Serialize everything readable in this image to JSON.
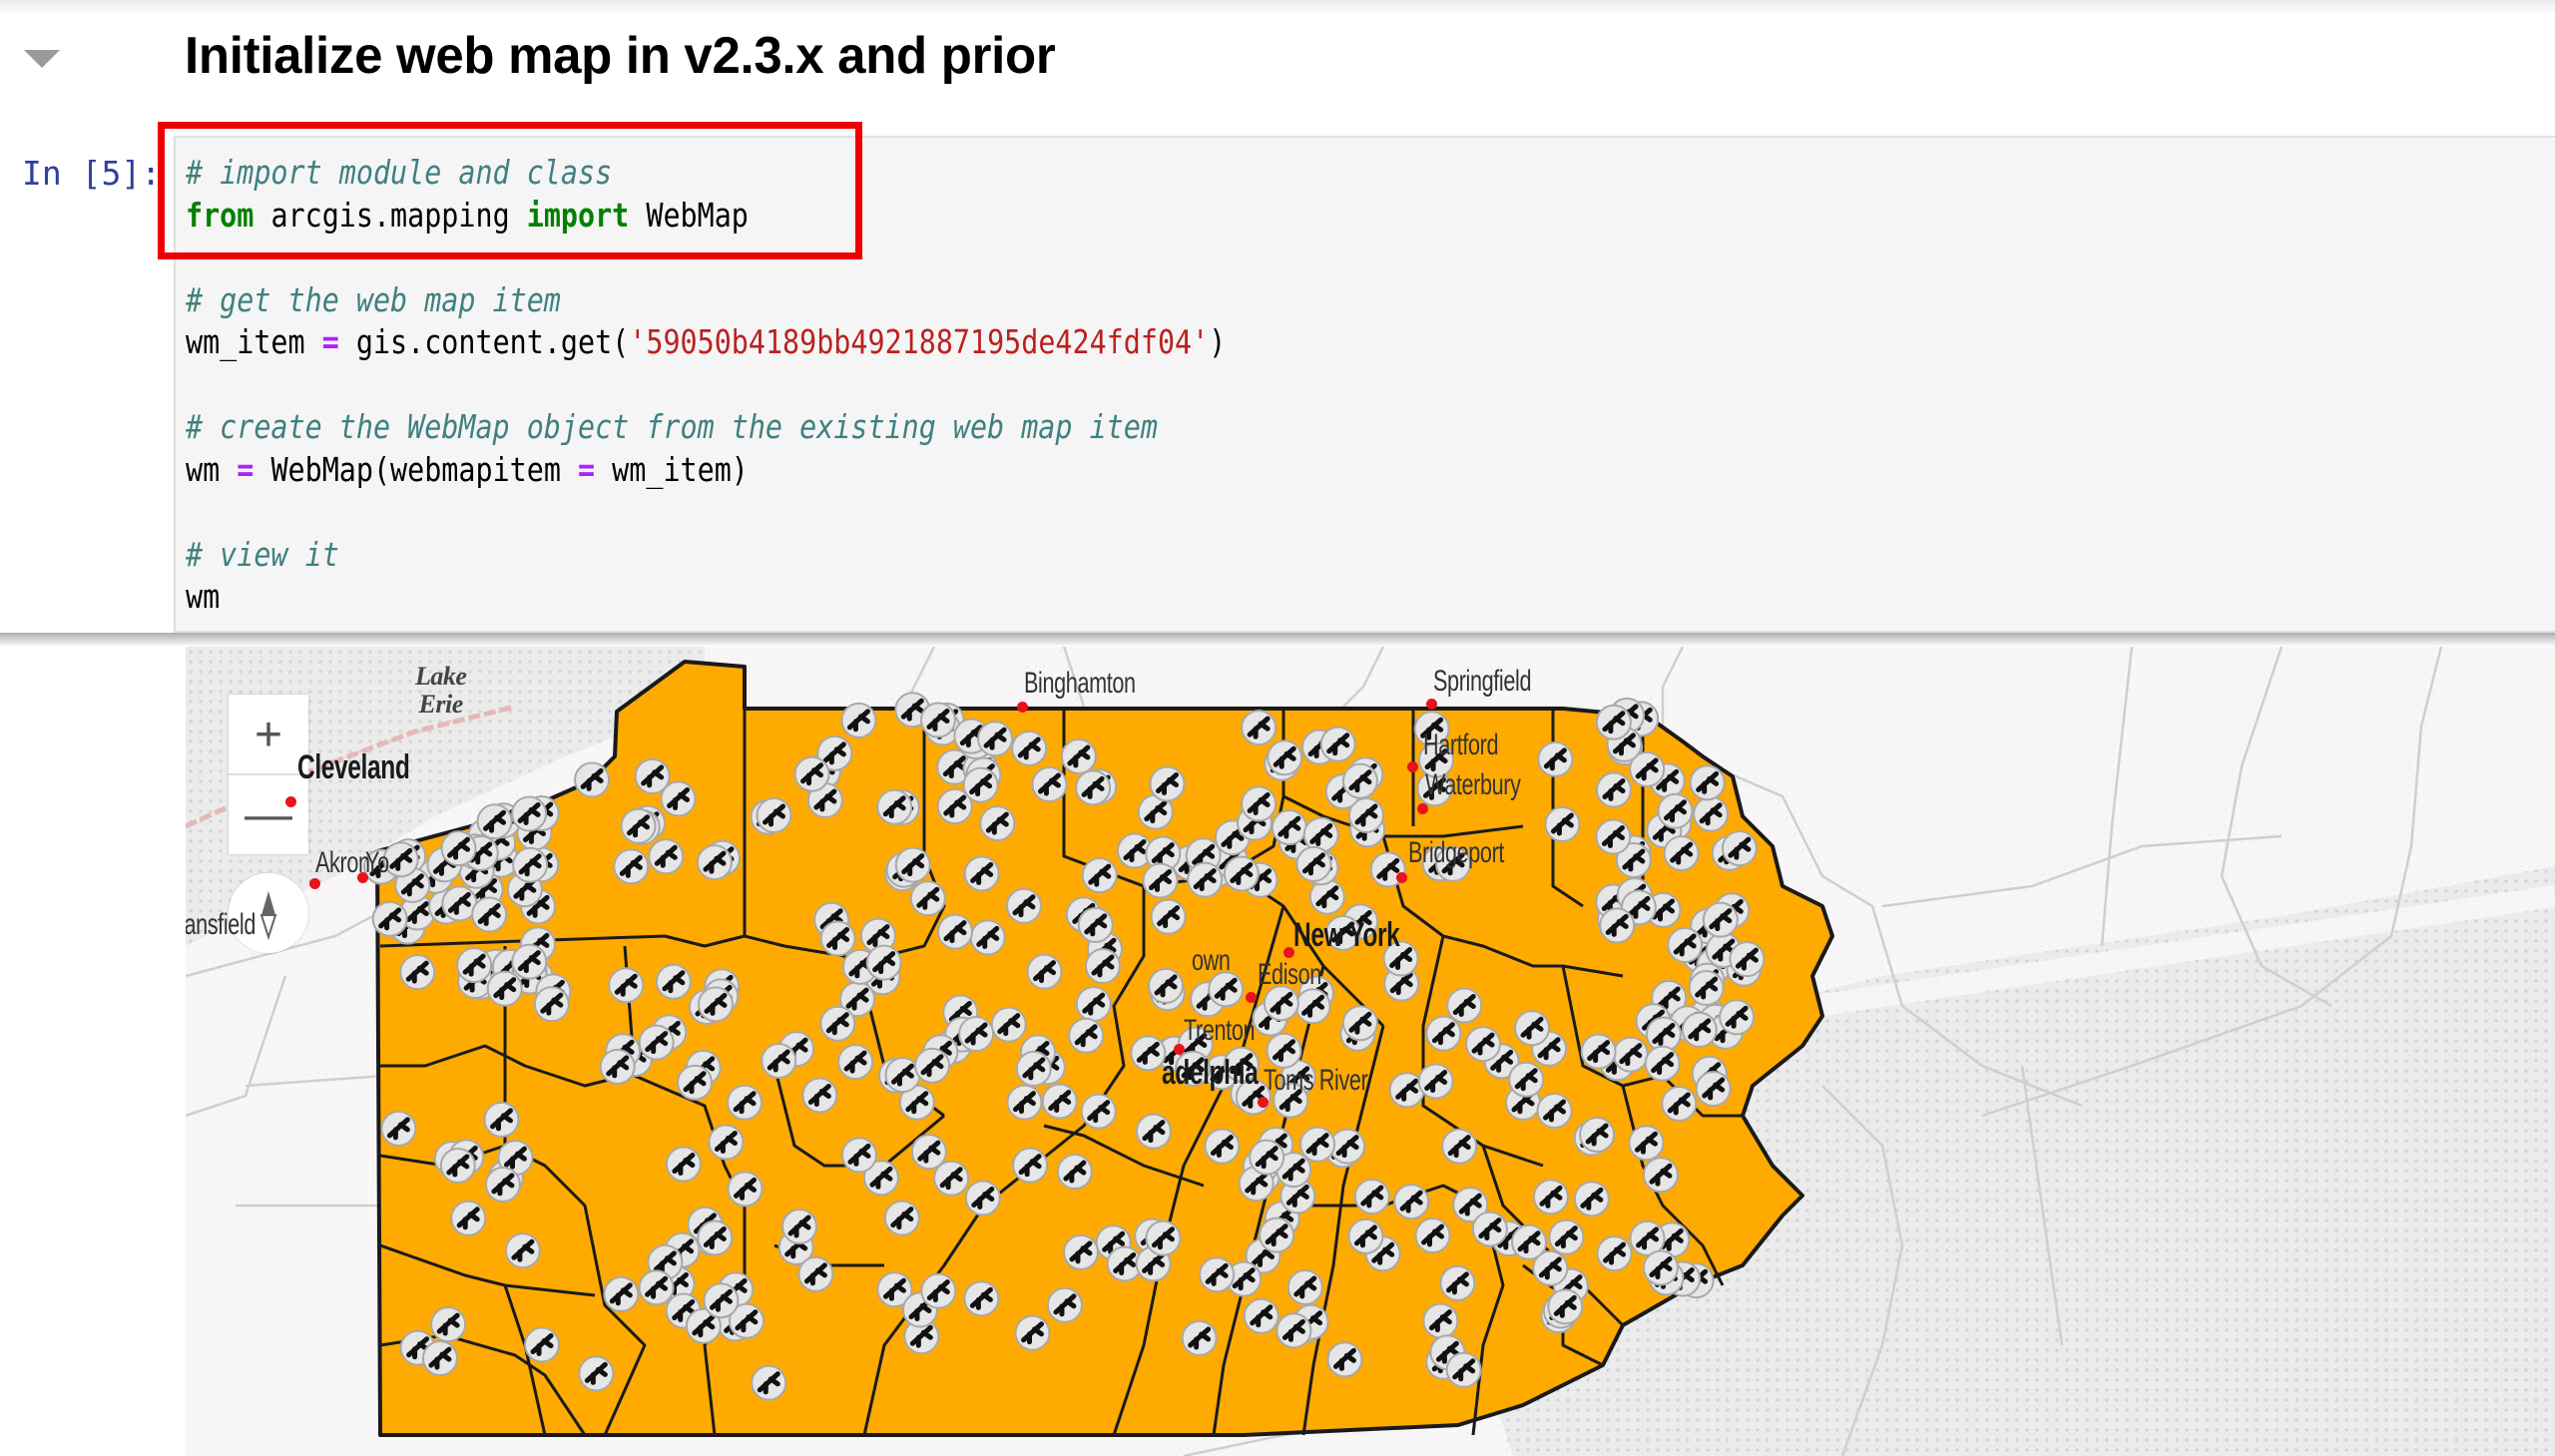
{
  "notebook": {
    "section_heading": "Initialize web map in v2.3.x and prior",
    "cell_prompt": "In [5]:",
    "code_lines": [
      {
        "parts": [
          {
            "t": "cm",
            "v": "# import module and class"
          }
        ]
      },
      {
        "parts": [
          {
            "t": "kw",
            "v": "from"
          },
          {
            "t": "",
            "v": " arcgis.mapping "
          },
          {
            "t": "kw",
            "v": "import"
          },
          {
            "t": "",
            "v": " WebMap"
          }
        ]
      },
      {
        "parts": []
      },
      {
        "parts": [
          {
            "t": "cm",
            "v": "# get the web map item"
          }
        ]
      },
      {
        "parts": [
          {
            "t": "",
            "v": "wm_item "
          },
          {
            "t": "op",
            "v": "="
          },
          {
            "t": "",
            "v": " gis.content.get("
          },
          {
            "t": "st",
            "v": "'59050b4189bb4921887195de424fdf04'"
          },
          {
            "t": "",
            "v": ")"
          }
        ]
      },
      {
        "parts": []
      },
      {
        "parts": [
          {
            "t": "cm",
            "v": "# create the WebMap object from the existing web map item"
          }
        ]
      },
      {
        "parts": [
          {
            "t": "",
            "v": "wm "
          },
          {
            "t": "op",
            "v": "="
          },
          {
            "t": "",
            "v": " WebMap(webmapitem "
          },
          {
            "t": "op",
            "v": "="
          },
          {
            "t": "",
            "v": " wm_item)"
          }
        ]
      },
      {
        "parts": []
      },
      {
        "parts": [
          {
            "t": "cm",
            "v": "# view it"
          }
        ]
      },
      {
        "parts": [
          {
            "t": "",
            "v": "wm"
          }
        ]
      }
    ],
    "highlight_color": "#ee0000"
  },
  "map": {
    "controls": {
      "zoom_in": "+",
      "zoom_out": "—",
      "compass": "compass-icon"
    },
    "state_fill": "#ffaa00",
    "marker_icon": "airport-icon",
    "water_labels": [
      {
        "name": "Lake\nErie"
      }
    ],
    "cities": [
      {
        "name": "Cleveland",
        "big": true
      },
      {
        "name": "Akron",
        "big": false
      },
      {
        "name": "Yo",
        "big": false
      },
      {
        "name": "lansfield",
        "big": false
      },
      {
        "name": "Binghamton",
        "big": false
      },
      {
        "name": "Springfield",
        "big": false
      },
      {
        "name": "Hartford",
        "big": false
      },
      {
        "name": "Waterbury",
        "big": false
      },
      {
        "name": "Bridgeport",
        "big": false
      },
      {
        "name": "New York",
        "big": true
      },
      {
        "name": "Edison",
        "big": false
      },
      {
        "name": "Trenton",
        "big": false
      },
      {
        "name": "adelphia",
        "big": true
      },
      {
        "name": "Toms River",
        "big": false
      },
      {
        "name": "own",
        "big": false
      }
    ]
  }
}
